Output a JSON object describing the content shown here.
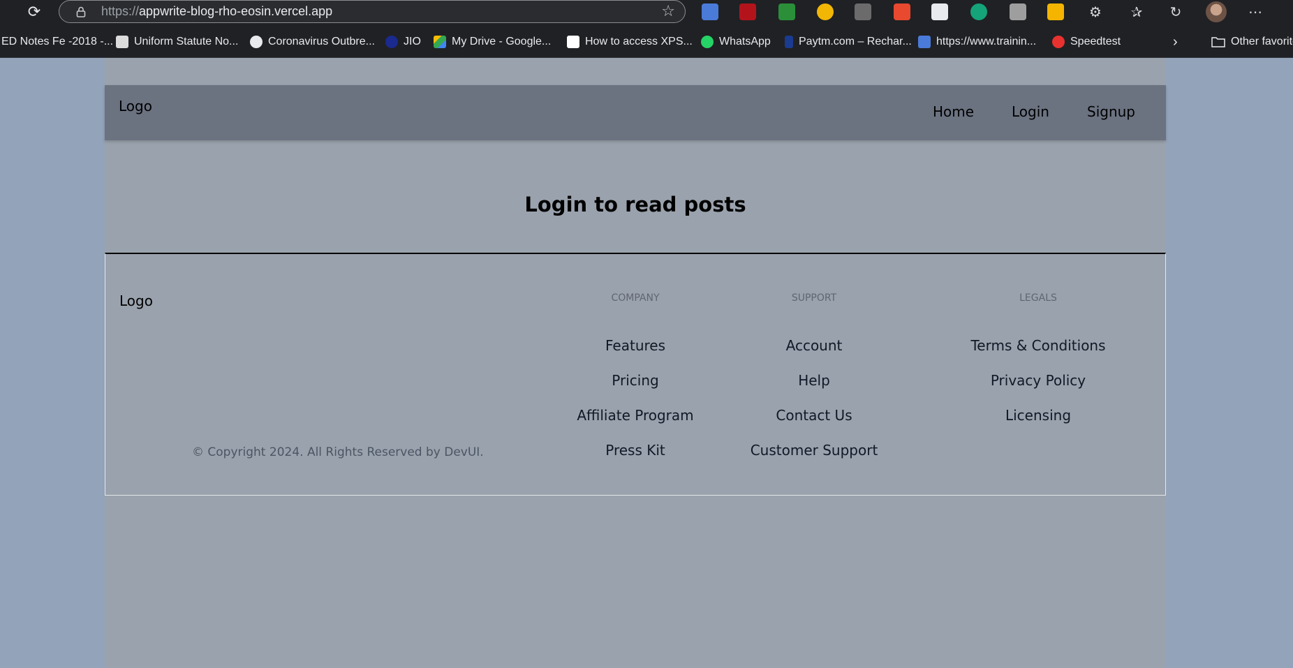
{
  "browser": {
    "url_protocol": "https://",
    "url_host": "appwrite-blog-rho-eosin.vercel.app",
    "bookmarks": [
      {
        "label": "ED Notes Fe -2018 -...",
        "color": "#202124"
      },
      {
        "label": "Uniform Statute No...",
        "color": "#dcdcdc"
      },
      {
        "label": "Coronavirus Outbre...",
        "color": "#e8eaed"
      },
      {
        "label": "JIO",
        "color": "#1a2a8f"
      },
      {
        "label": "My Drive - Google...",
        "color": "#34a853"
      },
      {
        "label": "How to access XPS...",
        "color": "#ffffff"
      },
      {
        "label": "WhatsApp",
        "color": "#25d366"
      },
      {
        "label": "Paytm.com – Rechar...",
        "color": "#1a3b8f"
      },
      {
        "label": "https://www.trainin...",
        "color": "#4a7bd8"
      },
      {
        "label": "Speedtest",
        "color": "#e8322f"
      }
    ],
    "other_favorites": "Other favorite"
  },
  "header": {
    "logo": "Logo",
    "nav": [
      "Home",
      "Login",
      "Signup"
    ]
  },
  "main": {
    "headline": "Login to read posts"
  },
  "footer": {
    "logo": "Logo",
    "copyright": "© Copyright 2024. All Rights Reserved by DevUI.",
    "columns": [
      {
        "title": "Company",
        "links": [
          "Features",
          "Pricing",
          "Affiliate Program",
          "Press Kit"
        ]
      },
      {
        "title": "Support",
        "links": [
          "Account",
          "Help",
          "Contact Us",
          "Customer Support"
        ]
      },
      {
        "title": "Legals",
        "links": [
          "Terms & Conditions",
          "Privacy Policy",
          "Licensing"
        ]
      }
    ]
  },
  "colors": {
    "background": "#93a3b9",
    "page": "#9aa2ad",
    "header": "#6b7280"
  }
}
